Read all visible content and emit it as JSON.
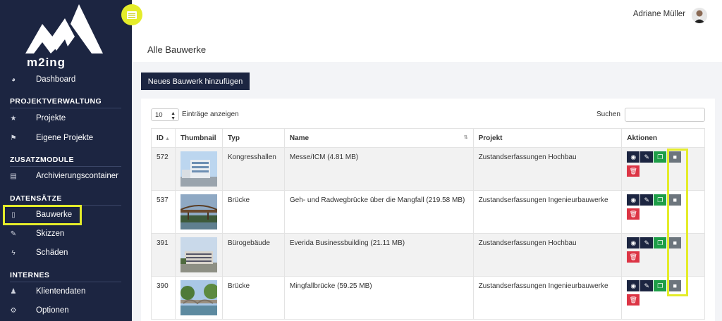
{
  "brand": {
    "logo_text": "m2ing"
  },
  "sidebar": {
    "items": [
      {
        "label": "Dashboard",
        "icon": "gauge-icon"
      },
      {
        "section": "PROJEKTVERWALTUNG"
      },
      {
        "label": "Projekte",
        "icon": "star-icon"
      },
      {
        "label": "Eigene Projekte",
        "icon": "flag-icon"
      },
      {
        "section": "ZUSATZMODULE"
      },
      {
        "label": "Archivierungscontainer",
        "icon": "archive-icon"
      },
      {
        "section": "DATENSÄTZE"
      },
      {
        "label": "Bauwerke",
        "icon": "building-icon",
        "active": true
      },
      {
        "label": "Skizzen",
        "icon": "pencil-square-icon"
      },
      {
        "label": "Schäden",
        "icon": "bolt-icon"
      },
      {
        "section": "INTERNES"
      },
      {
        "label": "Klientendaten",
        "icon": "person-icon"
      },
      {
        "label": "Optionen",
        "icon": "cogs-icon"
      }
    ]
  },
  "topbar": {
    "user_name": "Adriane Müller"
  },
  "page": {
    "title": "Alle Bauwerke",
    "add_button": "Neues Bauwerk hinzufügen"
  },
  "table_controls": {
    "length_value": "10",
    "length_label": "Einträge anzeigen",
    "search_label": "Suchen"
  },
  "table": {
    "headers": {
      "id": "ID",
      "thumbnail": "Thumbnail",
      "typ": "Typ",
      "name": "Name",
      "projekt": "Projekt",
      "aktionen": "Aktionen"
    },
    "rows": [
      {
        "id": "572",
        "typ": "Kongresshallen",
        "name": "Messe/ICM (4.81 MB)",
        "projekt": "Zustandserfassungen Hochbau"
      },
      {
        "id": "537",
        "typ": "Brücke",
        "name": "Geh- und Radwegbrücke über die Mangfall (219.58 MB)",
        "projekt": "Zustandserfassungen Ingenieurbauwerke"
      },
      {
        "id": "391",
        "typ": "Bürogebäude",
        "name": "Everida Businessbuilding (21.11 MB)",
        "projekt": "Zustandserfassungen Hochbau"
      },
      {
        "id": "390",
        "typ": "Brücke",
        "name": "Mingfallbrücke (59.25 MB)",
        "projekt": "Zustandserfassungen Ingenieurbauwerke"
      }
    ]
  },
  "colors": {
    "sidebar": "#1c2541",
    "highlight": "#e4ec2a",
    "copy": "#1e9e48",
    "delete": "#dc3545",
    "archive": "#6c757d"
  }
}
